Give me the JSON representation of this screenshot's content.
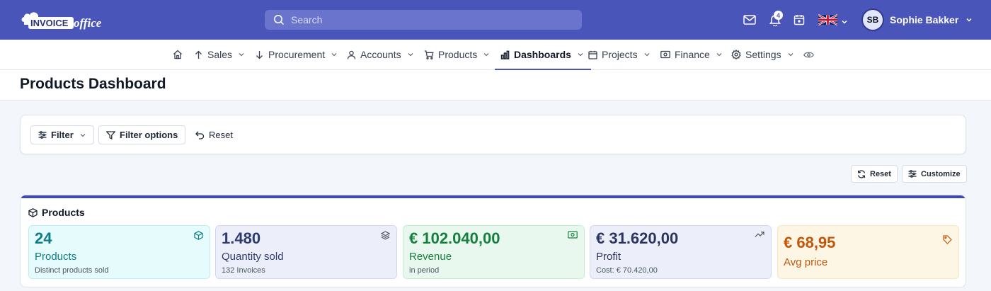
{
  "app": {
    "logo_text": "INVOICE office"
  },
  "header": {
    "search_placeholder": "Search",
    "notification_count": "4",
    "user_initials": "SB",
    "user_name": "Sophie Bakker"
  },
  "nav": {
    "items": [
      {
        "label": "Sales"
      },
      {
        "label": "Procurement"
      },
      {
        "label": "Accounts"
      },
      {
        "label": "Products"
      },
      {
        "label": "Dashboards"
      },
      {
        "label": "Projects"
      },
      {
        "label": "Finance"
      },
      {
        "label": "Settings"
      }
    ],
    "active": "Dashboards"
  },
  "page": {
    "title": "Products Dashboard"
  },
  "filters": {
    "filter_label": "Filter",
    "filter_options_label": "Filter options",
    "reset_label": "Reset"
  },
  "toolbar": {
    "reset_label": "Reset",
    "customize_label": "Customize"
  },
  "products_section": {
    "title": "Products",
    "kpis": [
      {
        "value": "24",
        "label": "Products",
        "sub": "Distinct products sold"
      },
      {
        "value": "1.480",
        "label": "Quantity sold",
        "sub": "132 Invoices"
      },
      {
        "value": "€ 102.040,00",
        "label": "Revenue",
        "sub": "in period"
      },
      {
        "value": "€ 31.620,00",
        "label": "Profit",
        "sub": "Cost: € 70.420,00"
      },
      {
        "value": "€ 68,95",
        "label": "Avg price"
      }
    ]
  },
  "colors": {
    "brand": "#4a55b9",
    "accent": "#3f4aad"
  }
}
